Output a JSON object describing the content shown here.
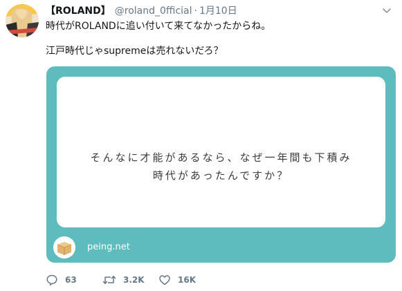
{
  "tweet": {
    "display_name": "【ROLAND】",
    "handle": "@roland_0fficial",
    "separator": "·",
    "date": "1月10日",
    "text_line1": "時代がROLANDに追い付いて来てなかったからね。",
    "text_line2": "江戸時代じゃsupremeは売れないだろ？"
  },
  "card": {
    "question_line1": "そんなに才能があるなら、なぜ一年間も下積み",
    "question_line2": "時代があったんですか？",
    "site": "peing.net",
    "background_color": "#5ebcbe"
  },
  "actions": {
    "reply_count": "63",
    "retweet_count": "3.2K",
    "like_count": "16K"
  },
  "icons": {
    "menu": "chevron-down-icon",
    "reply": "reply-icon",
    "retweet": "retweet-icon",
    "like": "heart-icon",
    "site_logo": "box-icon"
  },
  "colors": {
    "secondary_text": "#657786",
    "primary_text": "#14171a"
  }
}
